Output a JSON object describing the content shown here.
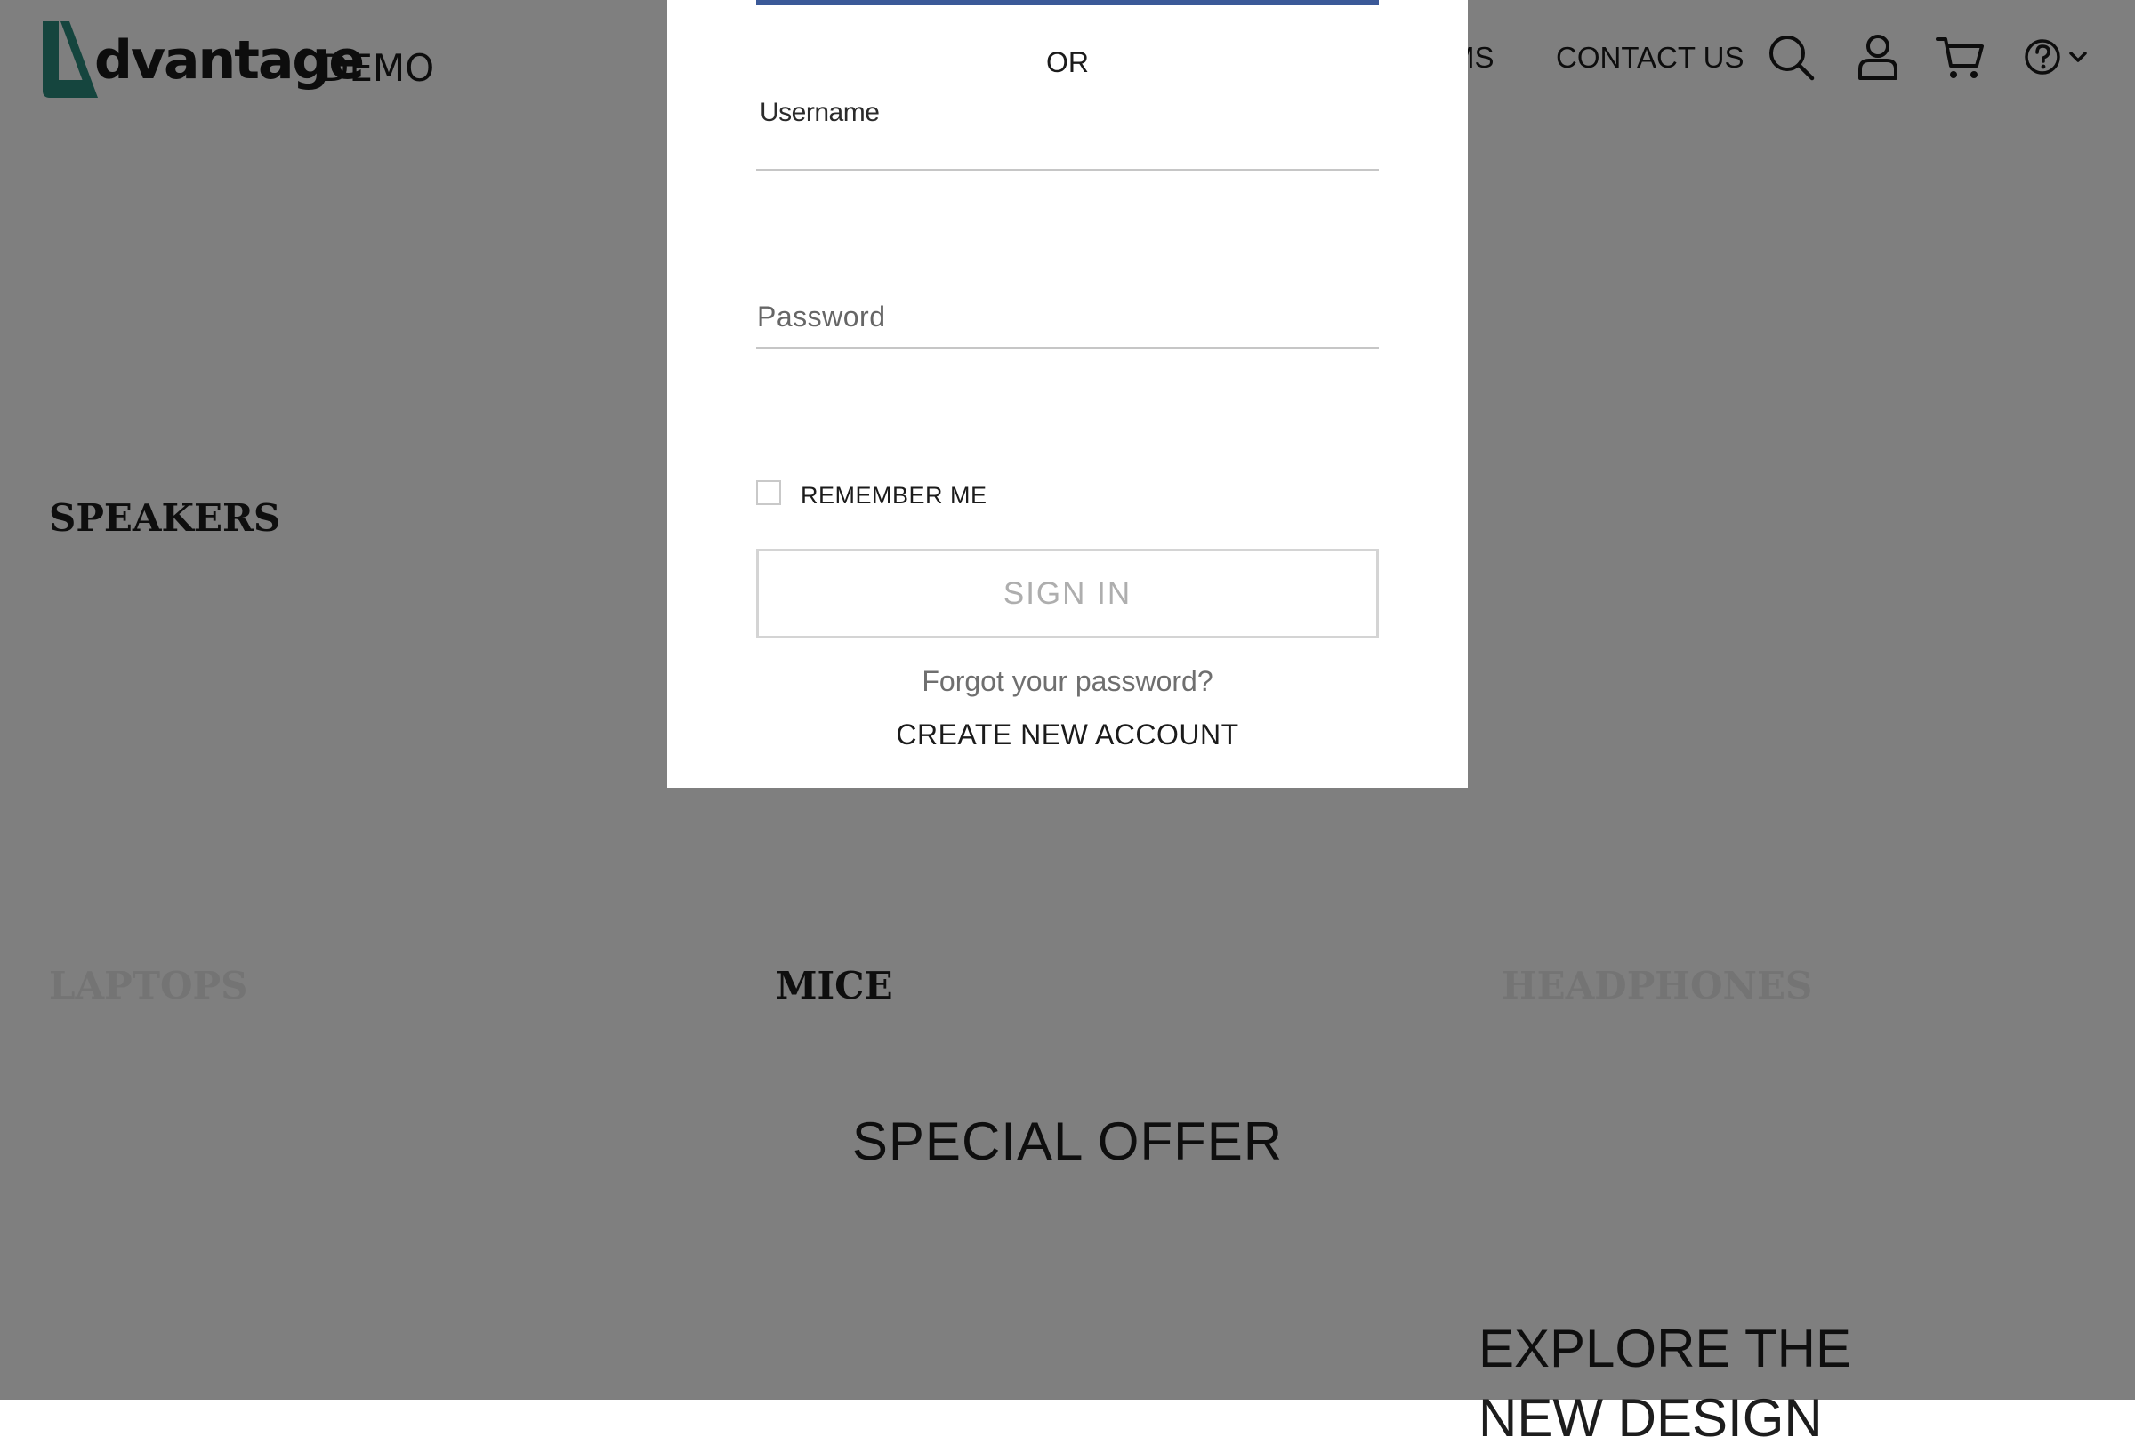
{
  "header": {
    "logo_word": "dvantage",
    "logo_demo": "DEMO",
    "nav_items_partial": "MS",
    "nav_contact": "CONTACT US",
    "icons": [
      "search-icon",
      "user-icon",
      "cart-icon",
      "help-icon",
      "chevron-down-icon"
    ]
  },
  "categories": {
    "speakers": "SPEAKERS",
    "laptops": "LAPTOPS",
    "mice": "MICE",
    "headphones": "HEADPHONES"
  },
  "special_offer": {
    "title": "SPECIAL OFFER",
    "explore": "EXPLORE THE NEW DESIGN"
  },
  "login_modal": {
    "or_text": "OR",
    "username_label": "Username",
    "username_value": "",
    "password_label": "Password",
    "password_value": "",
    "remember_label": "REMEMBER ME",
    "remember_checked": false,
    "signin_label": "SIGN IN",
    "forgot_label": "Forgot your password?",
    "create_label": "CREATE NEW ACCOUNT"
  },
  "colors": {
    "overlay": "rgba(0,0,0,0.5)",
    "facebook_blue": "#3b5998",
    "logo_teal": "#2a8a7c",
    "signin_text_disabled": "#aeaeae"
  }
}
